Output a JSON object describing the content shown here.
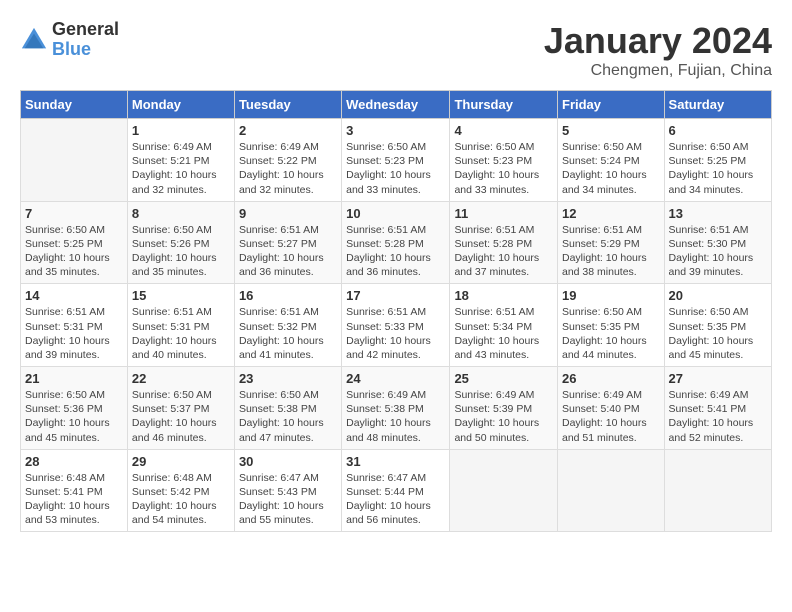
{
  "header": {
    "logo_line1": "General",
    "logo_line2": "Blue",
    "month_title": "January 2024",
    "subtitle": "Chengmen, Fujian, China"
  },
  "weekdays": [
    "Sunday",
    "Monday",
    "Tuesday",
    "Wednesday",
    "Thursday",
    "Friday",
    "Saturday"
  ],
  "weeks": [
    [
      {
        "day": "",
        "info": ""
      },
      {
        "day": "1",
        "info": "Sunrise: 6:49 AM\nSunset: 5:21 PM\nDaylight: 10 hours\nand 32 minutes."
      },
      {
        "day": "2",
        "info": "Sunrise: 6:49 AM\nSunset: 5:22 PM\nDaylight: 10 hours\nand 32 minutes."
      },
      {
        "day": "3",
        "info": "Sunrise: 6:50 AM\nSunset: 5:23 PM\nDaylight: 10 hours\nand 33 minutes."
      },
      {
        "day": "4",
        "info": "Sunrise: 6:50 AM\nSunset: 5:23 PM\nDaylight: 10 hours\nand 33 minutes."
      },
      {
        "day": "5",
        "info": "Sunrise: 6:50 AM\nSunset: 5:24 PM\nDaylight: 10 hours\nand 34 minutes."
      },
      {
        "day": "6",
        "info": "Sunrise: 6:50 AM\nSunset: 5:25 PM\nDaylight: 10 hours\nand 34 minutes."
      }
    ],
    [
      {
        "day": "7",
        "info": "Sunrise: 6:50 AM\nSunset: 5:25 PM\nDaylight: 10 hours\nand 35 minutes."
      },
      {
        "day": "8",
        "info": "Sunrise: 6:50 AM\nSunset: 5:26 PM\nDaylight: 10 hours\nand 35 minutes."
      },
      {
        "day": "9",
        "info": "Sunrise: 6:51 AM\nSunset: 5:27 PM\nDaylight: 10 hours\nand 36 minutes."
      },
      {
        "day": "10",
        "info": "Sunrise: 6:51 AM\nSunset: 5:28 PM\nDaylight: 10 hours\nand 36 minutes."
      },
      {
        "day": "11",
        "info": "Sunrise: 6:51 AM\nSunset: 5:28 PM\nDaylight: 10 hours\nand 37 minutes."
      },
      {
        "day": "12",
        "info": "Sunrise: 6:51 AM\nSunset: 5:29 PM\nDaylight: 10 hours\nand 38 minutes."
      },
      {
        "day": "13",
        "info": "Sunrise: 6:51 AM\nSunset: 5:30 PM\nDaylight: 10 hours\nand 39 minutes."
      }
    ],
    [
      {
        "day": "14",
        "info": "Sunrise: 6:51 AM\nSunset: 5:31 PM\nDaylight: 10 hours\nand 39 minutes."
      },
      {
        "day": "15",
        "info": "Sunrise: 6:51 AM\nSunset: 5:31 PM\nDaylight: 10 hours\nand 40 minutes."
      },
      {
        "day": "16",
        "info": "Sunrise: 6:51 AM\nSunset: 5:32 PM\nDaylight: 10 hours\nand 41 minutes."
      },
      {
        "day": "17",
        "info": "Sunrise: 6:51 AM\nSunset: 5:33 PM\nDaylight: 10 hours\nand 42 minutes."
      },
      {
        "day": "18",
        "info": "Sunrise: 6:51 AM\nSunset: 5:34 PM\nDaylight: 10 hours\nand 43 minutes."
      },
      {
        "day": "19",
        "info": "Sunrise: 6:50 AM\nSunset: 5:35 PM\nDaylight: 10 hours\nand 44 minutes."
      },
      {
        "day": "20",
        "info": "Sunrise: 6:50 AM\nSunset: 5:35 PM\nDaylight: 10 hours\nand 45 minutes."
      }
    ],
    [
      {
        "day": "21",
        "info": "Sunrise: 6:50 AM\nSunset: 5:36 PM\nDaylight: 10 hours\nand 45 minutes."
      },
      {
        "day": "22",
        "info": "Sunrise: 6:50 AM\nSunset: 5:37 PM\nDaylight: 10 hours\nand 46 minutes."
      },
      {
        "day": "23",
        "info": "Sunrise: 6:50 AM\nSunset: 5:38 PM\nDaylight: 10 hours\nand 47 minutes."
      },
      {
        "day": "24",
        "info": "Sunrise: 6:49 AM\nSunset: 5:38 PM\nDaylight: 10 hours\nand 48 minutes."
      },
      {
        "day": "25",
        "info": "Sunrise: 6:49 AM\nSunset: 5:39 PM\nDaylight: 10 hours\nand 50 minutes."
      },
      {
        "day": "26",
        "info": "Sunrise: 6:49 AM\nSunset: 5:40 PM\nDaylight: 10 hours\nand 51 minutes."
      },
      {
        "day": "27",
        "info": "Sunrise: 6:49 AM\nSunset: 5:41 PM\nDaylight: 10 hours\nand 52 minutes."
      }
    ],
    [
      {
        "day": "28",
        "info": "Sunrise: 6:48 AM\nSunset: 5:41 PM\nDaylight: 10 hours\nand 53 minutes."
      },
      {
        "day": "29",
        "info": "Sunrise: 6:48 AM\nSunset: 5:42 PM\nDaylight: 10 hours\nand 54 minutes."
      },
      {
        "day": "30",
        "info": "Sunrise: 6:47 AM\nSunset: 5:43 PM\nDaylight: 10 hours\nand 55 minutes."
      },
      {
        "day": "31",
        "info": "Sunrise: 6:47 AM\nSunset: 5:44 PM\nDaylight: 10 hours\nand 56 minutes."
      },
      {
        "day": "",
        "info": ""
      },
      {
        "day": "",
        "info": ""
      },
      {
        "day": "",
        "info": ""
      }
    ]
  ]
}
